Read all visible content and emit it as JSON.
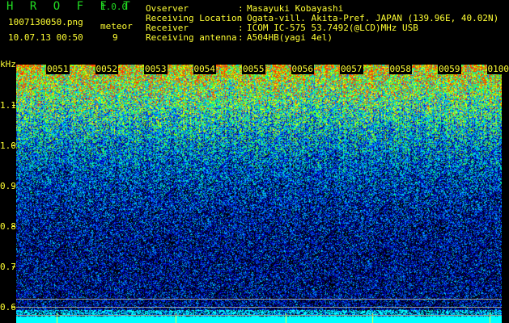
{
  "app": {
    "title": "H R O F F T",
    "version": "1.0.0"
  },
  "file": {
    "name": "1007130050.png",
    "datetime": "10.07.13 00:50"
  },
  "meteor": {
    "label": "meteor",
    "count": "9"
  },
  "info": [
    {
      "label": "Ovserver",
      "value": "Masayuki Kobayashi"
    },
    {
      "label": "Receiving Location",
      "value": "Ogata-vill. Akita-Pref. JAPAN (139.96E, 40.02N)"
    },
    {
      "label": "Receiver",
      "value": "ICOM IC-575 53.7492(@LCD)MHz USB"
    },
    {
      "label": "Receiving antenna",
      "value": "A504HB(yagi 4el)"
    }
  ],
  "axis": {
    "unit": "kHz",
    "y_ticks": [
      "1.1",
      "1.0",
      "0.9",
      "0.8",
      "0.7",
      "0.6"
    ],
    "time_labels": [
      "0051",
      "0052",
      "0053",
      "0054",
      "0055",
      "0056",
      "0057",
      "0058",
      "0059",
      "0100"
    ]
  },
  "colors": {
    "text": "#ffff33",
    "title": "#22dd22",
    "baseline": "#00ffff"
  }
}
